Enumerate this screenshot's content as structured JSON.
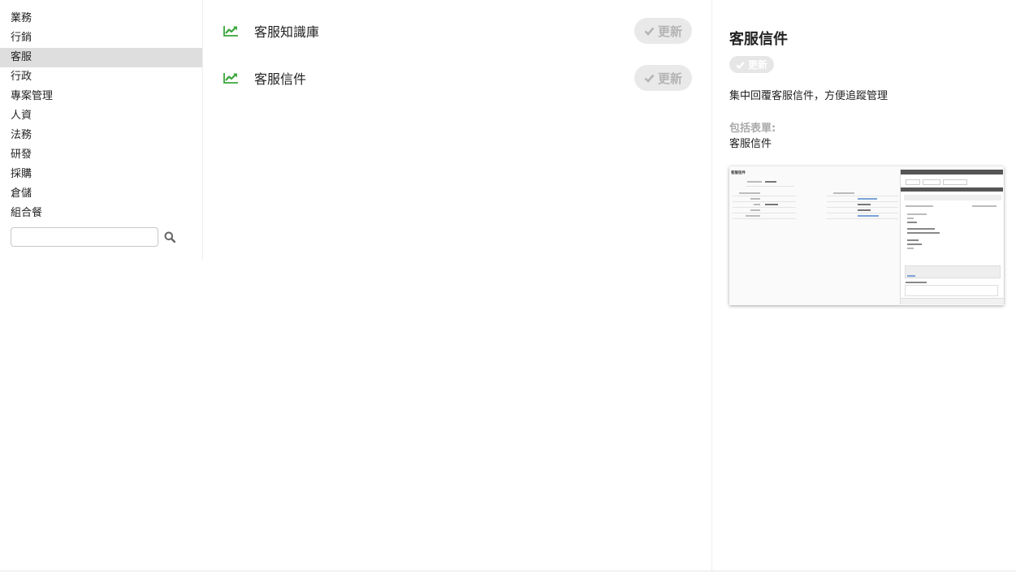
{
  "sidebar": {
    "categories": [
      "業務",
      "行銷",
      "客服",
      "行政",
      "專案管理",
      "人資",
      "法務",
      "研發",
      "採購",
      "倉儲",
      "組合餐"
    ],
    "active_index": 2,
    "search": {
      "value": "",
      "placeholder": ""
    }
  },
  "apps": [
    {
      "name": "客服知識庫",
      "button_label": "更新"
    },
    {
      "name": "客服信件",
      "button_label": "更新"
    }
  ],
  "detail": {
    "title": "客服信件",
    "badge_label": "更新",
    "description": "集中回覆客服信件，方便追蹤管理",
    "includes_label": "包括表單:",
    "includes_value": "客服信件",
    "preview": {
      "title": "客服信件"
    }
  },
  "colors": {
    "accent_green": "#3aa63a",
    "active_bg": "#dedede",
    "button_bg": "#e9e9e9",
    "button_text": "#b4b4b4"
  },
  "icons": {
    "app_icon": "trend-up-icon",
    "search": "search-icon",
    "check": "check-icon"
  }
}
